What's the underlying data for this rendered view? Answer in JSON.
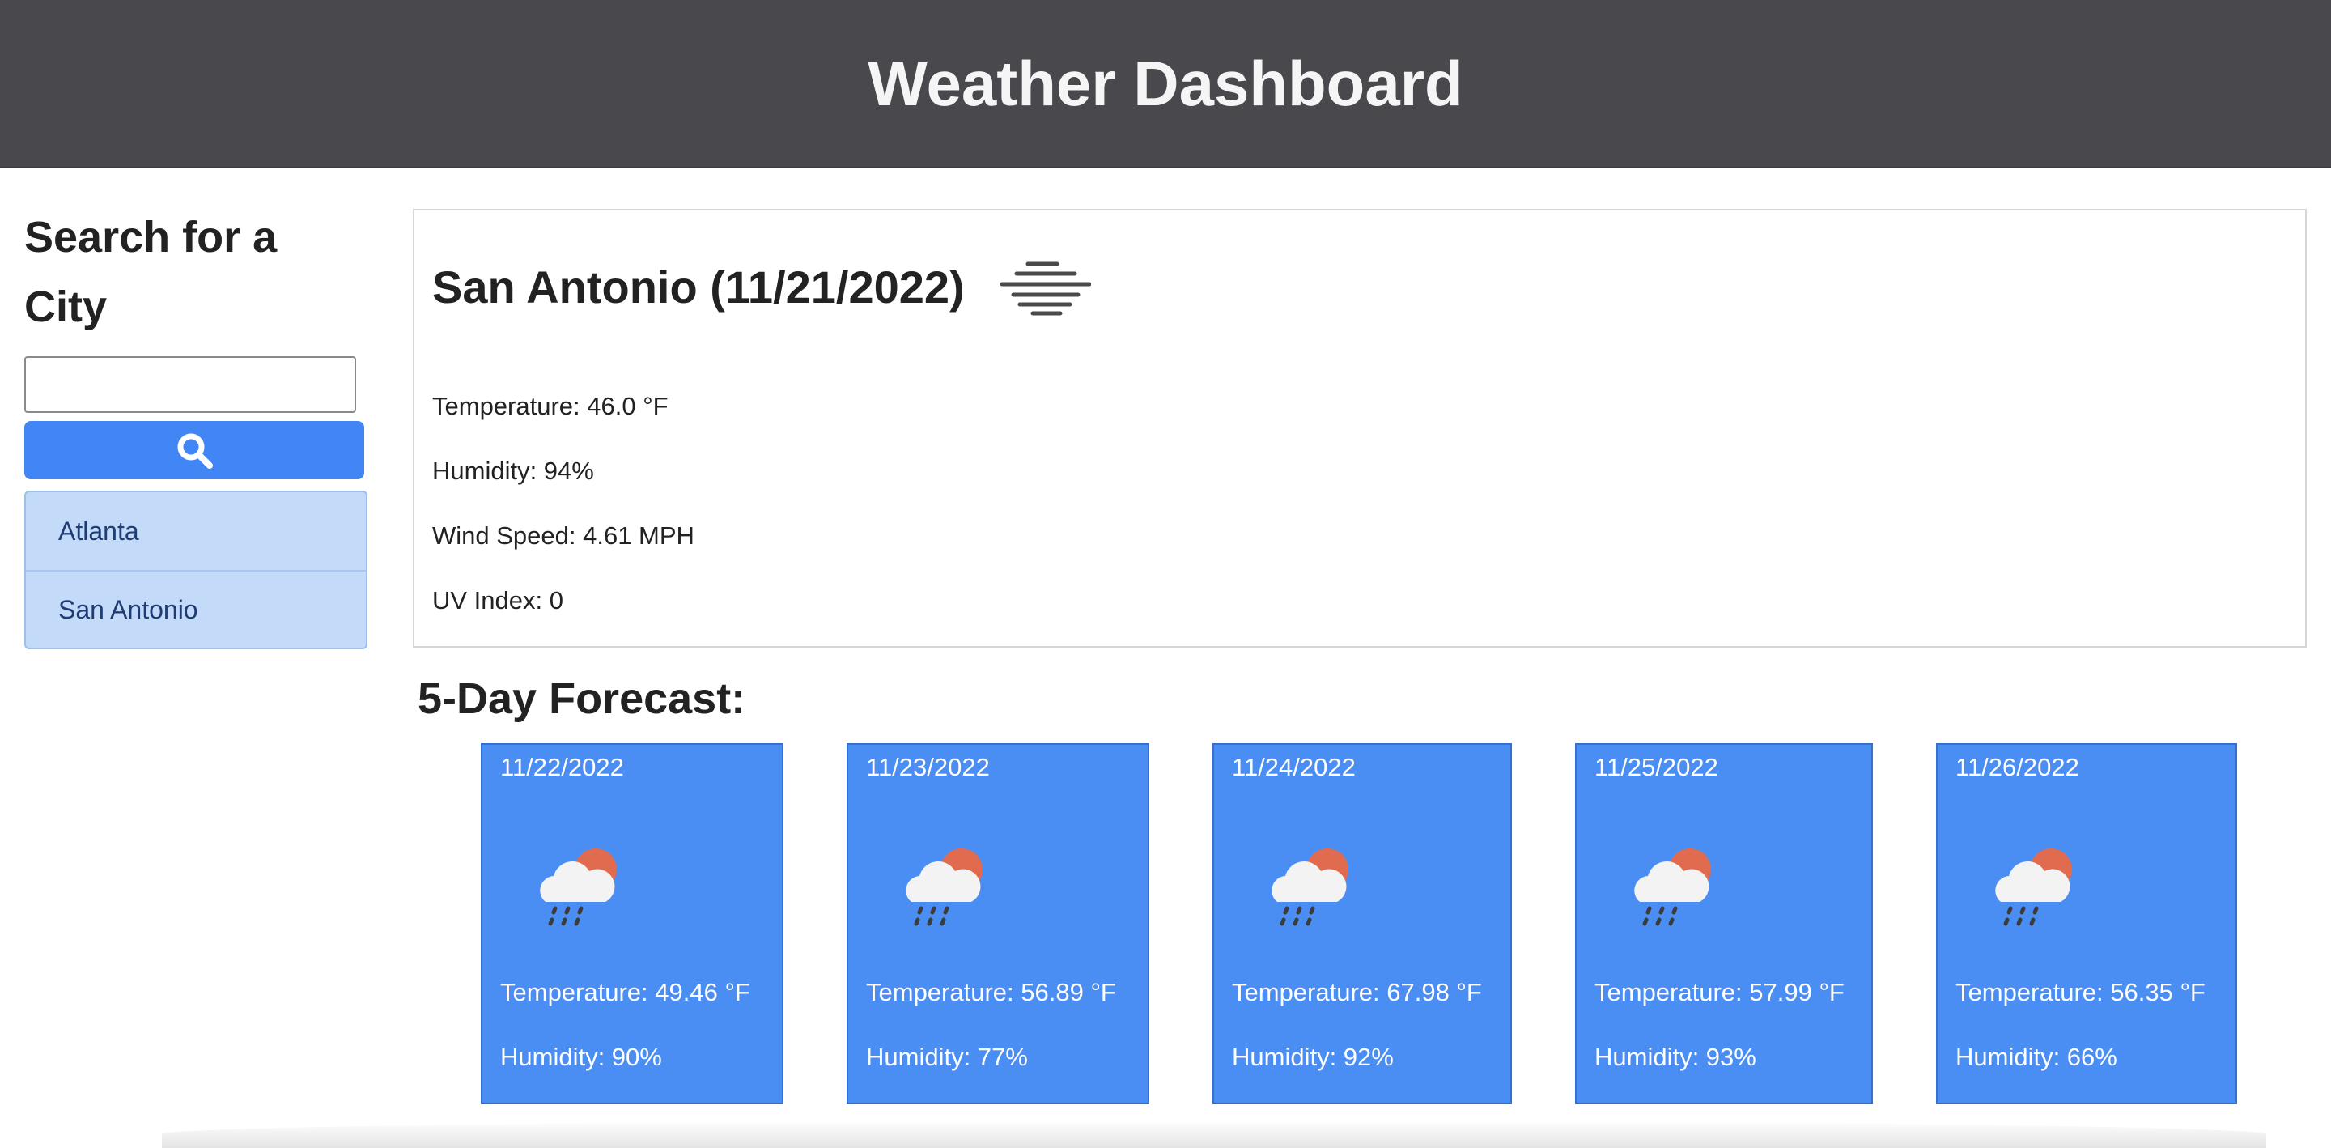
{
  "header": {
    "title": "Weather Dashboard"
  },
  "sidebar": {
    "heading": "Search for a City",
    "search_value": "",
    "search_button_icon": "search-icon",
    "history": [
      {
        "label": "Atlanta"
      },
      {
        "label": "San Antonio"
      }
    ]
  },
  "current": {
    "title": "San Antonio (11/21/2022)",
    "icon": "mist-icon",
    "temperature": "Temperature: 46.0 °F",
    "humidity": "Humidity: 94%",
    "wind": "Wind Speed: 4.61 MPH",
    "uv": "UV Index: 0"
  },
  "forecast": {
    "heading": "5-Day Forecast:",
    "days": [
      {
        "date": "11/22/2022",
        "icon": "rain-sun-icon",
        "temperature": "Temperature: 49.46 °F",
        "humidity": "Humidity: 90%"
      },
      {
        "date": "11/23/2022",
        "icon": "rain-sun-icon",
        "temperature": "Temperature: 56.89 °F",
        "humidity": "Humidity: 77%"
      },
      {
        "date": "11/24/2022",
        "icon": "rain-sun-icon",
        "temperature": "Temperature: 67.98 °F",
        "humidity": "Humidity: 92%"
      },
      {
        "date": "11/25/2022",
        "icon": "rain-sun-icon",
        "temperature": "Temperature: 57.99 °F",
        "humidity": "Humidity: 93%"
      },
      {
        "date": "11/26/2022",
        "icon": "rain-sun-icon",
        "temperature": "Temperature: 56.35 °F",
        "humidity": "Humidity: 66%"
      }
    ]
  },
  "colors": {
    "header_bg": "#48484d",
    "accent": "#4285f4",
    "card_bg": "#4a8ef4",
    "history_bg": "#c3daf9"
  }
}
